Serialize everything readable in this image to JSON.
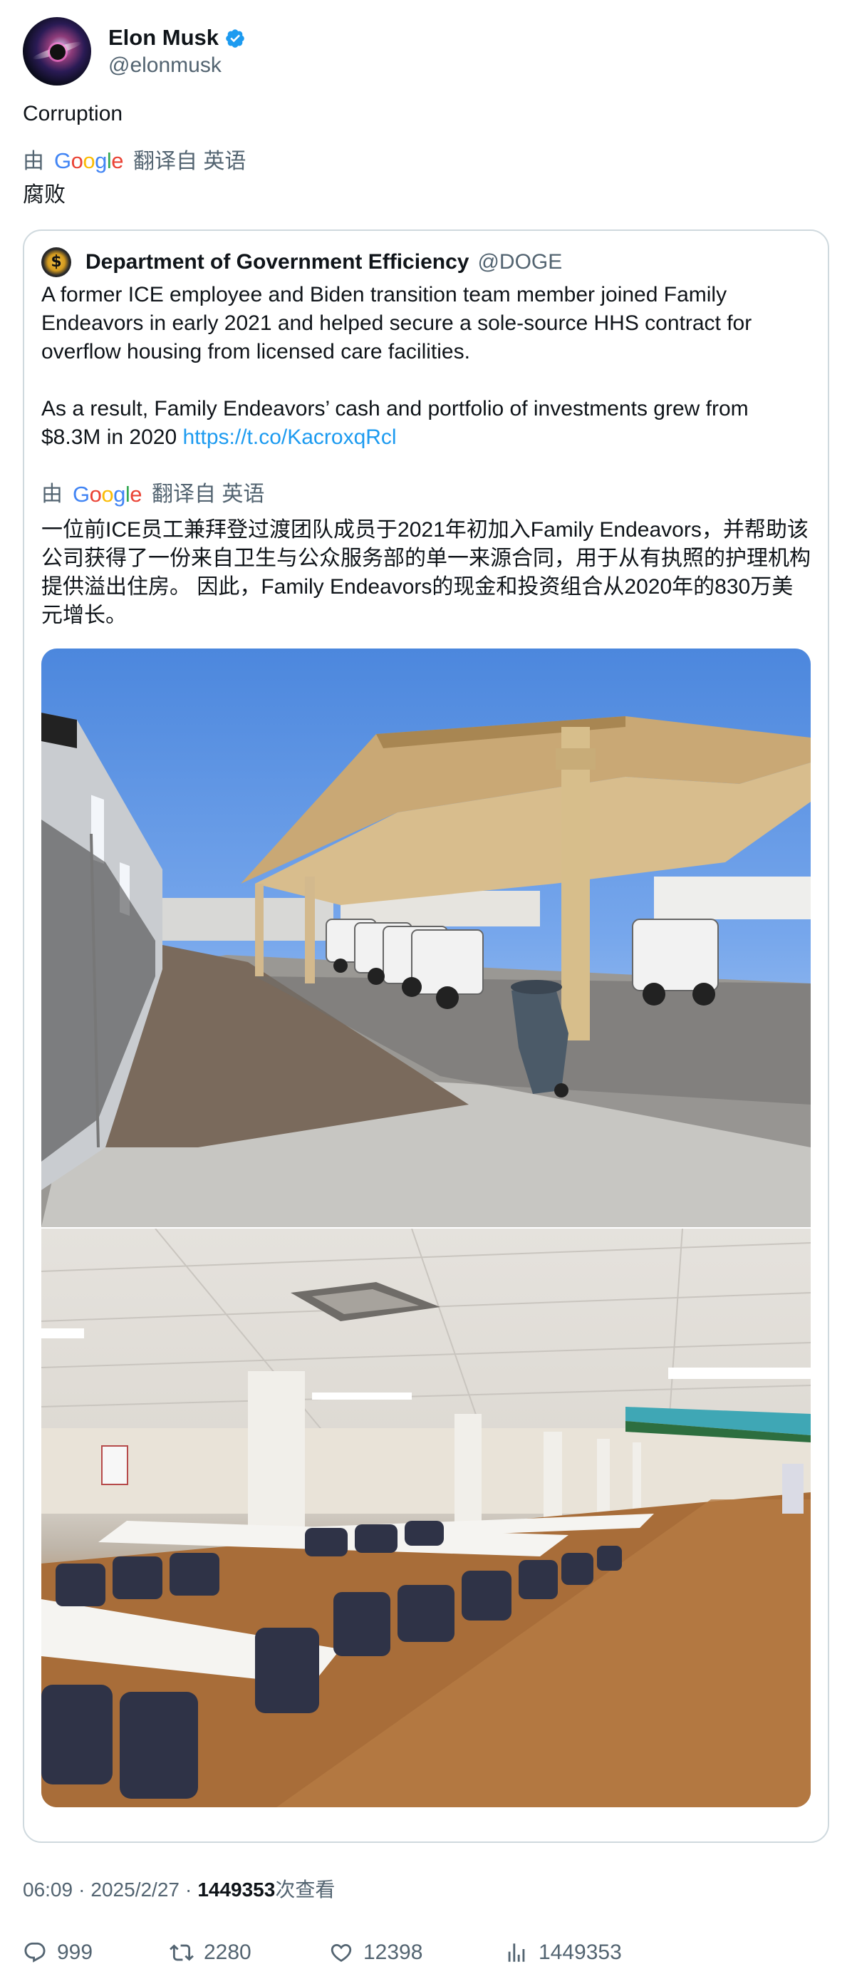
{
  "header": {
    "name": "Elon Musk",
    "handle": "@elonmusk"
  },
  "tweet": {
    "text": "Corruption",
    "translate": {
      "by": "由",
      "google": "Google",
      "translated_from": "翻译自 英语"
    },
    "translation": "腐败"
  },
  "quote": {
    "name": "Department of Government Efficiency",
    "handle": "@DOGE",
    "paragraph1": "A former ICE employee and Biden transition team member joined Family Endeavors in early 2021 and helped secure a sole-source HHS contract for overflow housing from licensed care facilities.",
    "paragraph2_text": "As a result, Family Endeavors’ cash and portfolio of investments grew from $8.3M in 2020 ",
    "paragraph2_link": "https://t.co/KacroxqRcl",
    "translate": {
      "by": "由",
      "google": "Google",
      "translated_from": "翻译自 英语"
    },
    "translation": "一位前ICE员工兼拜登过渡团队成员于2021年初加入Family Endeavors，并帮助该公司获得了一份来自卫生与公众服务部的单一来源合同，用于从有执照的护理机构提供溢出住房。 因此，Family Endeavors的现金和投资组合从2020年的830万美元增长。"
  },
  "meta": {
    "time": "06:09",
    "separator": "·",
    "date": "2025/2/27",
    "views_count": "1449353",
    "views_label": "次查看"
  },
  "actions": {
    "replies": "999",
    "retweets": "2280",
    "likes": "12398",
    "views": "1449353"
  },
  "colors": {
    "link": "#1d9bf0",
    "secondary_text": "#536471",
    "border": "#cfd9de",
    "verified": "#1d9bf0"
  },
  "icons": {
    "verified": "verified-badge-icon",
    "reply": "reply-icon",
    "retweet": "retweet-icon",
    "like": "heart-icon",
    "views": "views-chart-icon"
  }
}
